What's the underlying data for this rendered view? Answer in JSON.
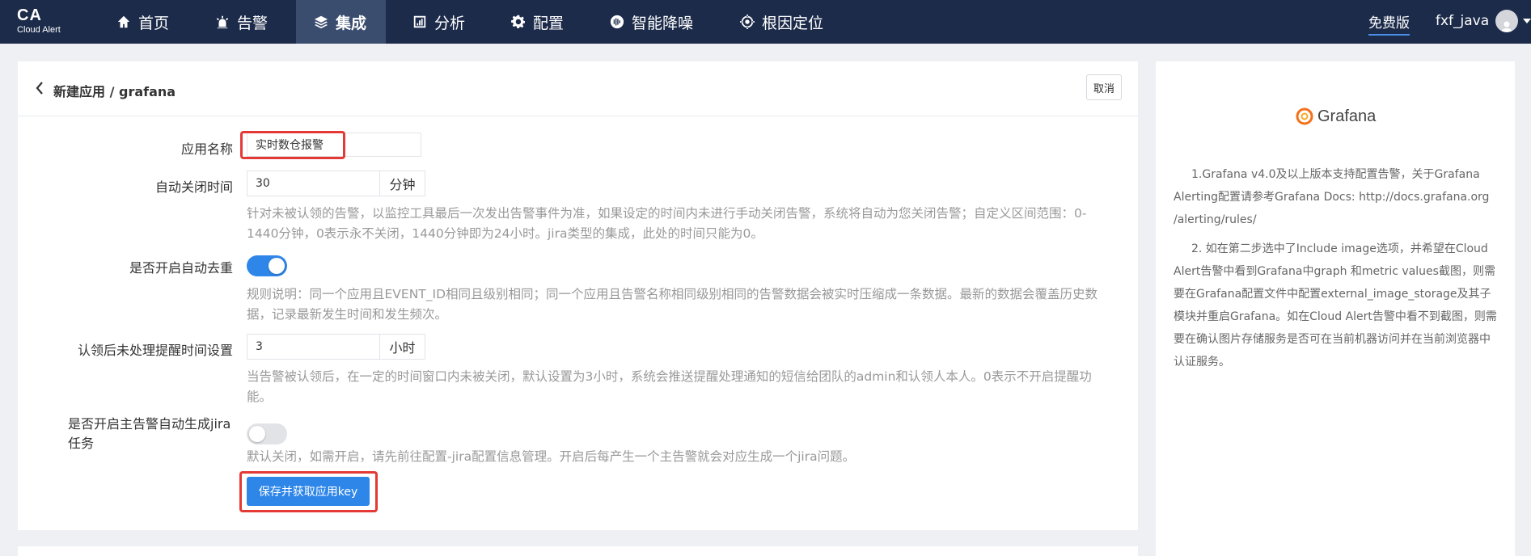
{
  "nav": {
    "logo_title": "CA",
    "logo_subtitle": "Cloud Alert",
    "items": [
      {
        "label": "首页",
        "icon": "home-icon"
      },
      {
        "label": "告警",
        "icon": "alarm-icon"
      },
      {
        "label": "集成",
        "icon": "layers-icon"
      },
      {
        "label": "分析",
        "icon": "chart-icon"
      },
      {
        "label": "配置",
        "icon": "gear-icon"
      },
      {
        "label": "智能降噪",
        "icon": "noise-icon"
      },
      {
        "label": "根因定位",
        "icon": "target-icon"
      }
    ],
    "active_item": "集成",
    "free_version": "免费版",
    "username": "fxf_java"
  },
  "form": {
    "breadcrumb": "新建应用 / grafana",
    "cancel_label": "取消",
    "app_name_label": "应用名称",
    "app_name_value": "实时数仓报警",
    "auto_close_label": "自动关闭时间",
    "auto_close_value": "30",
    "auto_close_unit": "分钟",
    "auto_close_help": "针对未被认领的告警，以监控工具最后一次发出告警事件为准，如果设定的时间内未进行手动关闭告警，系统将自动为您关闭告警；自定义区间范围：0-1440分钟，0表示永不关闭，1440分钟即为24小时。jira类型的集成，此处的时间只能为0。",
    "dedup_label": "是否开启自动去重",
    "dedup_enabled": true,
    "dedup_help": "规则说明：同一个应用且EVENT_ID相同且级别相同；同一个应用且告警名称相同级别相同的告警数据会被实时压缩成一条数据。最新的数据会覆盖历史数据，记录最新发生时间和发生频次。",
    "remind_label": "认领后未处理提醒时间设置",
    "remind_value": "3",
    "remind_unit": "小时",
    "remind_help": "当告警被认领后，在一定的时间窗口内未被关闭，默认设置为3小时，系统会推送提醒处理通知的短信给团队的admin和认领人本人。0表示不开启提醒功能。",
    "jira_label": "是否开启主告警自动生成jira任务",
    "jira_enabled": false,
    "jira_help": "默认关闭，如需开启，请先前往配置-jira配置信息管理。开启后每产生一个主告警就会对应生成一个jira问题。",
    "save_label": "保存并获取应用key"
  },
  "side": {
    "brand": "Grafana",
    "para1": "1.Grafana v4.0及以上版本支持配置告警，关于Grafana Alerting配置请参考Grafana Docs: http://docs.grafana.org /alerting/rules/",
    "para2": "2. 如在第二步选中了Include image选项，并希望在Cloud Alert告警中看到Grafana中graph 和metric values截图，则需要在Grafana配置文件中配置external_image_storage及其子模块并重启Grafana。如在Cloud Alert告警中看不到截图，则需要在确认图片存储服务是否可在当前机器访问并在当前浏览器中认证服务。"
  },
  "colors": {
    "nav_bg": "#1c2b4a",
    "accent": "#2e86e8",
    "highlight": "#e53935"
  }
}
